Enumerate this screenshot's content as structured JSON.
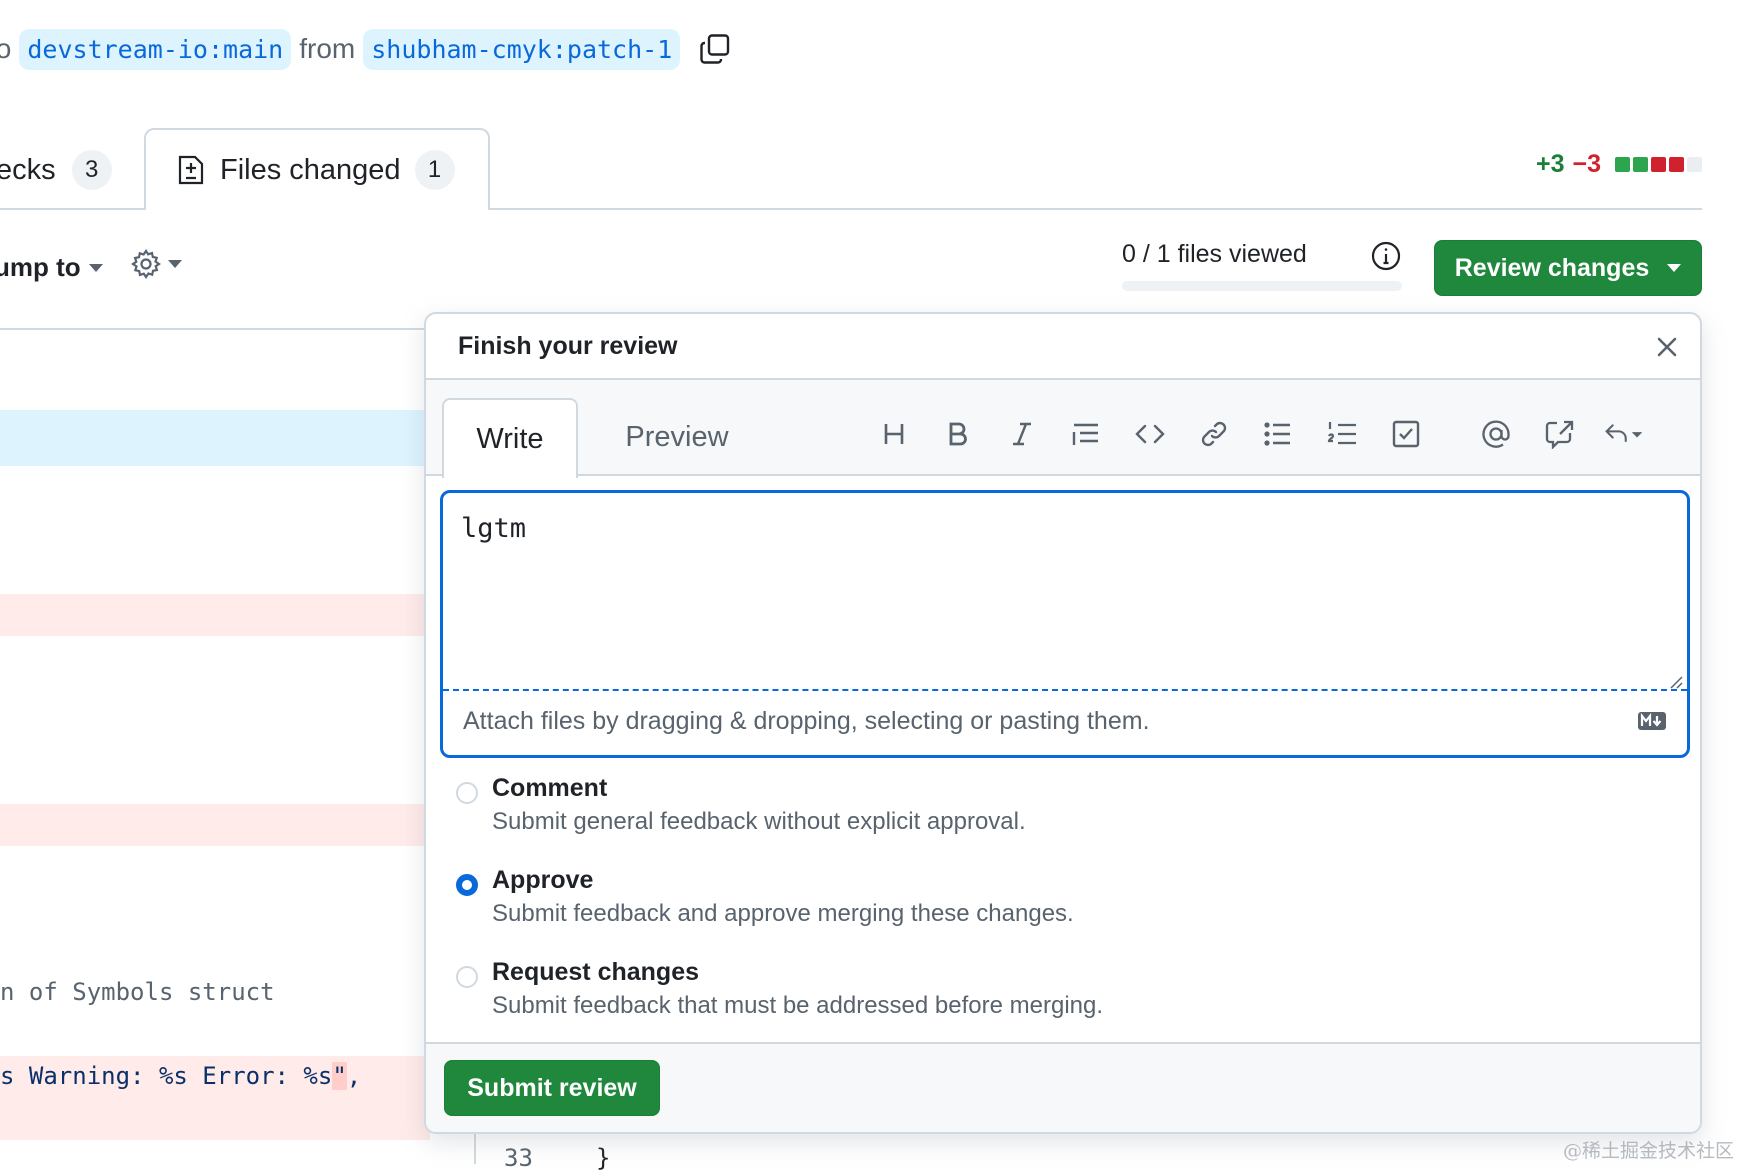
{
  "branch": {
    "lead": "to",
    "base": "devstream-io:main",
    "connector": "from",
    "head": "shubham-cmyk:patch-1"
  },
  "tabs": {
    "checks": {
      "label": "ecks",
      "count": "3"
    },
    "files_changed": {
      "label": "Files changed",
      "count": "1"
    }
  },
  "diffstat": {
    "additions": "+3",
    "deletions": "−3",
    "boxes": [
      "#2da44e",
      "#2da44e",
      "#cf222e",
      "#cf222e",
      "#eaeef2"
    ]
  },
  "toolbar": {
    "jump_to": "ump to",
    "files_viewed": "0 / 1 files viewed",
    "files_viewed_progress": 0,
    "review_changes": "Review changes"
  },
  "background_code": {
    "line1": "n of Symbols struct",
    "line2_pre": "s Warning: %s Error: %s",
    "line2_hl": "\"",
    "line2_post": ",",
    "bottom_line_no": "33",
    "bottom_code": "}"
  },
  "review": {
    "title": "Finish your review",
    "tab_write": "Write",
    "tab_preview": "Preview",
    "toolbar_icons": [
      "heading-icon",
      "bold-icon",
      "italic-icon",
      "quote-icon",
      "code-icon",
      "link-icon",
      "unordered-list-icon",
      "ordered-list-icon",
      "task-list-icon",
      "mention-icon",
      "reference-icon",
      "reply-icon"
    ],
    "comment_text": "lgtm",
    "attach_hint": "Attach files by dragging & dropping, selecting or pasting them.",
    "options": [
      {
        "label": "Comment",
        "desc": "Submit general feedback without explicit approval.",
        "checked": false
      },
      {
        "label": "Approve",
        "desc": "Submit feedback and approve merging these changes.",
        "checked": true
      },
      {
        "label": "Request changes",
        "desc": "Submit feedback that must be addressed before merging.",
        "checked": false
      }
    ],
    "submit": "Submit review"
  },
  "watermark": "@稀土掘金技术社区",
  "colors": {
    "accent": "#0969da",
    "primary_button": "#1f883d",
    "addition": "#1a7f37",
    "deletion": "#cf222e"
  }
}
